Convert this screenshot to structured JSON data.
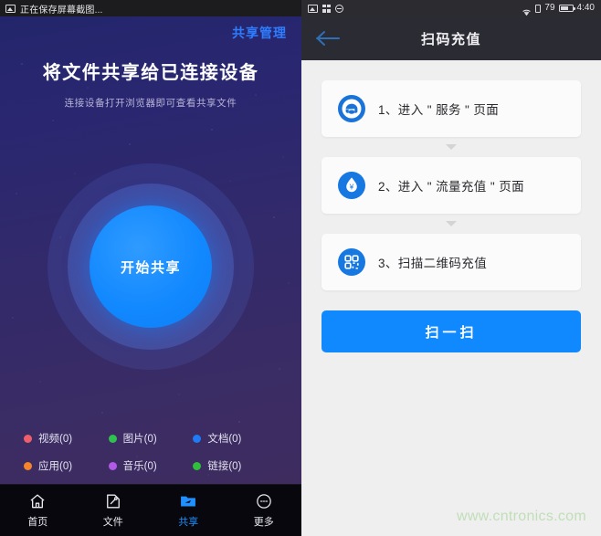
{
  "left_phone": {
    "status_bar": {
      "icon": "photo-icon",
      "text": "正在保存屏幕截图..."
    },
    "share_manage_link": "共享管理",
    "hero": {
      "title": "将文件共享给已连接设备",
      "subtitle": "连接设备打开浏览器即可查看共享文件"
    },
    "orb": {
      "label": "开始共享",
      "core_color": "#1389ff"
    },
    "legend": [
      {
        "label": "视频(0)",
        "color": "#ef5f6b",
        "icon": "video-dot-icon"
      },
      {
        "label": "图片(0)",
        "color": "#2fc14f",
        "icon": "image-dot-icon"
      },
      {
        "label": "文档(0)",
        "color": "#1e7bf5",
        "icon": "document-dot-icon"
      },
      {
        "label": "应用(0)",
        "color": "#f4852b",
        "icon": "app-dot-icon"
      },
      {
        "label": "音乐(0)",
        "color": "#b259e8",
        "icon": "music-dot-icon"
      },
      {
        "label": "链接(0)",
        "color": "#2fbf3a",
        "icon": "link-dot-icon"
      }
    ],
    "tabs": [
      {
        "label": "首页",
        "icon": "home-icon",
        "active": false
      },
      {
        "label": "文件",
        "icon": "file-icon",
        "active": false
      },
      {
        "label": "共享",
        "icon": "folder-share-icon",
        "active": true
      },
      {
        "label": "更多",
        "icon": "more-icon",
        "active": false
      }
    ],
    "active_tab_color": "#1e90ff"
  },
  "right_phone": {
    "status_bar": {
      "left_icons": [
        "photo-icon",
        "grid-icon",
        "clock-icon"
      ],
      "right_icons": [
        "wifi-icon",
        "sim-icon",
        "battery-icon"
      ],
      "battery_level": "79",
      "time": "4:40"
    },
    "navbar": {
      "back_icon": "back-arrow-icon",
      "title": "扫码充值"
    },
    "steps": [
      {
        "text": "1、进入 \" 服务 \" 页面",
        "icon": "headset-icon",
        "icon_bg": "#1a73d8"
      },
      {
        "text": "2、进入 \" 流量充值 \" 页面",
        "icon": "water-drop-yuan-icon",
        "icon_bg": "#1678e0"
      },
      {
        "text": "3、扫描二维码充值",
        "icon": "qr-code-icon",
        "icon_bg": "#1678e0"
      }
    ],
    "scan_button": {
      "label": "扫一扫",
      "color": "#1089ff"
    },
    "watermark": "www.cntronics.com"
  }
}
